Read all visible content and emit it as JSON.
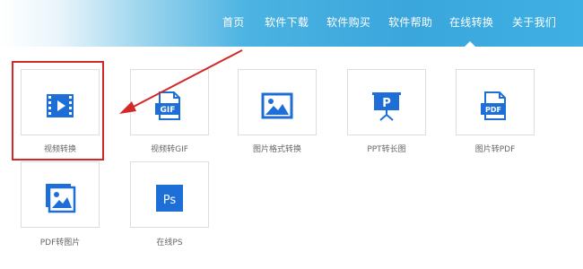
{
  "nav": {
    "items": [
      {
        "label": "首页"
      },
      {
        "label": "软件下载"
      },
      {
        "label": "软件购买"
      },
      {
        "label": "软件帮助"
      },
      {
        "label": "在线转换",
        "active": true
      },
      {
        "label": "关于我们"
      }
    ]
  },
  "tools": [
    {
      "label": "视频转换",
      "icon": "video-icon"
    },
    {
      "label": "视频转GIF",
      "icon": "gif-file-icon",
      "badge": "GIF"
    },
    {
      "label": "图片格式转换",
      "icon": "image-icon"
    },
    {
      "label": "PPT转长图",
      "icon": "presentation-icon",
      "badge": "P"
    },
    {
      "label": "图片转PDF",
      "icon": "pdf-file-icon",
      "badge": "PDF"
    },
    {
      "label": "PDF转图片",
      "icon": "image-gallery-icon"
    },
    {
      "label": "在线PS",
      "icon": "photoshop-icon",
      "badge": "Ps"
    }
  ],
  "colors": {
    "icon_blue": "#1e6ed8",
    "highlight_red": "#d22828",
    "nav_text": "#ffffff",
    "label_text": "#666666"
  }
}
